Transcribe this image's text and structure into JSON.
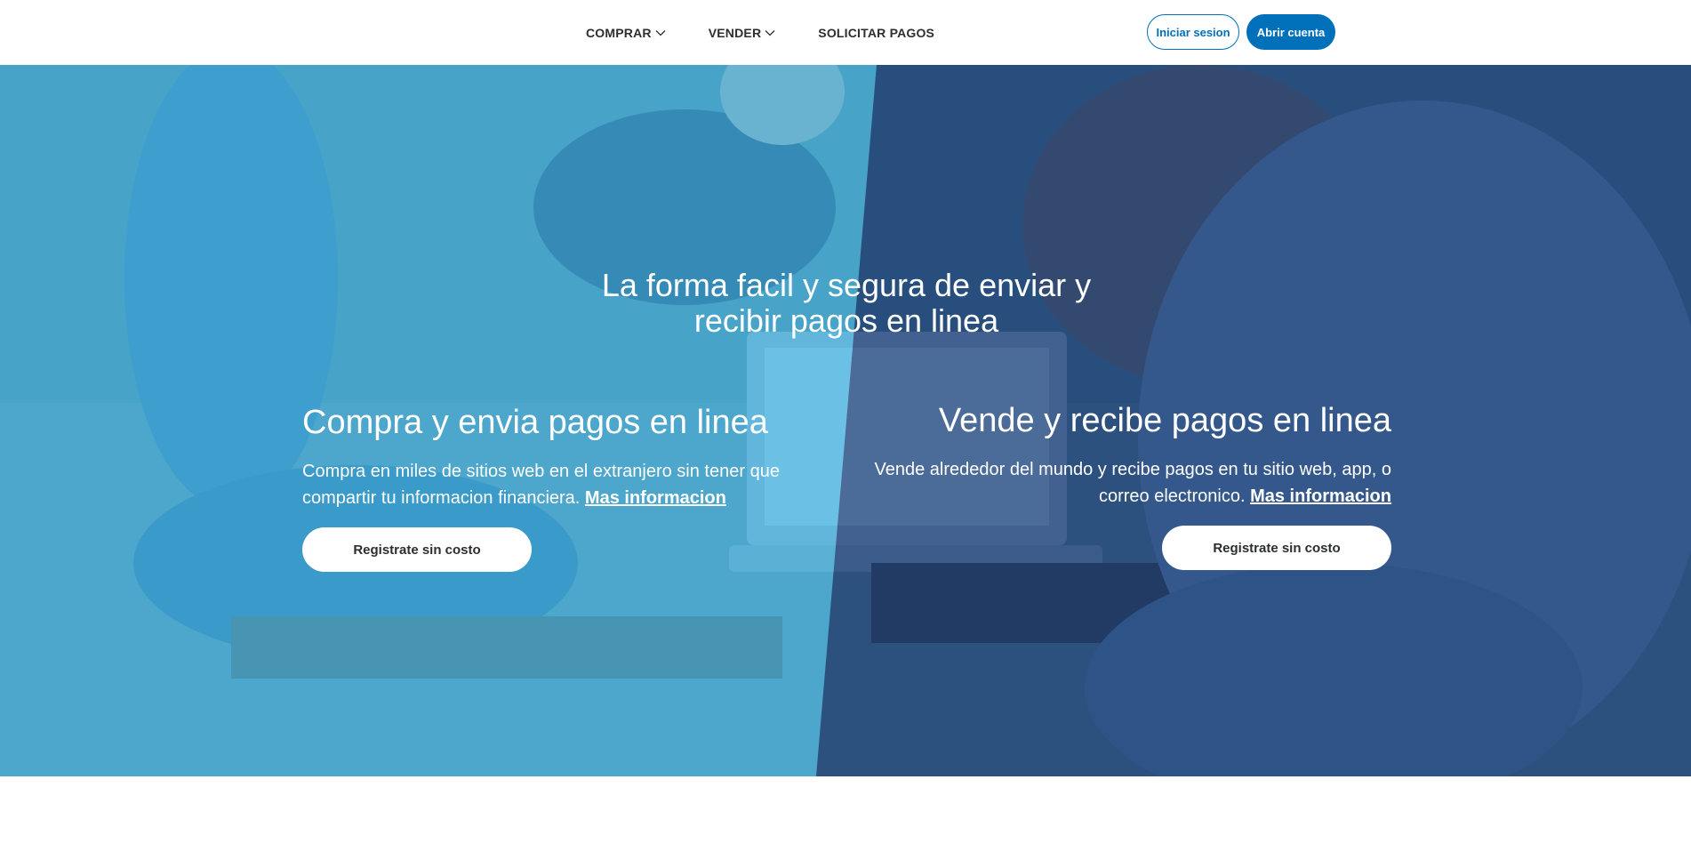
{
  "nav": {
    "items": [
      {
        "label": "COMPRAR",
        "has_dropdown": true
      },
      {
        "label": "VENDER",
        "has_dropdown": true
      },
      {
        "label": "SOLICITAR PAGOS",
        "has_dropdown": false
      }
    ]
  },
  "auth": {
    "login_label": "Iniciar sesion",
    "signup_label": "Abrir cuenta"
  },
  "hero": {
    "headline": "La forma facil y segura de enviar y recibir pagos en linea",
    "buy": {
      "title": "Compra y envia pagos en linea",
      "text": "Compra en miles de sitios web en el extranjero sin tener que compartir tu informacion financiera.",
      "link": "Mas informacion",
      "cta": "Registrate sin costo"
    },
    "sell": {
      "title": "Vende y recibe pagos en linea",
      "text": "Vende alrededor del mundo y recibe pagos en tu sitio web, app, o correo electronico.",
      "link": "Mas informacion",
      "cta": "Registrate sin costo"
    }
  },
  "colors": {
    "brand_blue": "#0070ba",
    "overlay_left": "#40b2e2",
    "overlay_right": "#143c78",
    "nav_text": "#2c2e2f"
  },
  "icons": {
    "dropdown": "chevron-down-icon"
  }
}
